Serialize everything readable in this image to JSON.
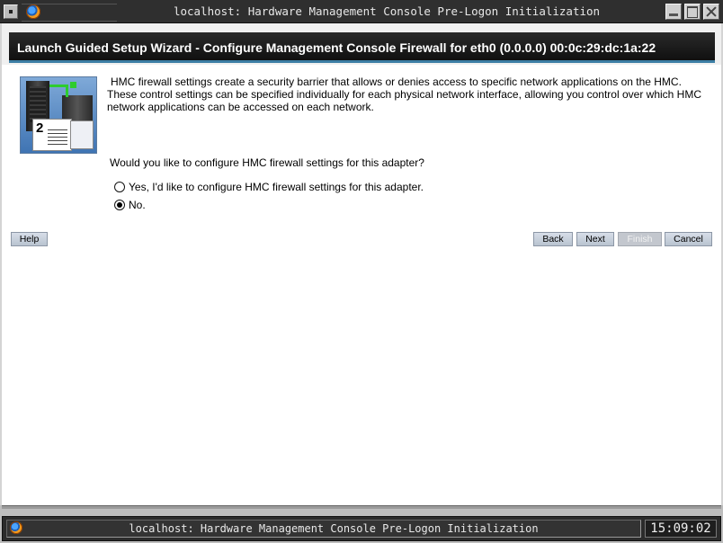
{
  "window": {
    "title": "localhost: Hardware Management Console Pre-Logon Initialization"
  },
  "wizard": {
    "heading": "Launch Guided Setup Wizard - Configure Management Console Firewall for eth0 (0.0.0.0) 00:0c:29:dc:1a:22",
    "step_number": "2",
    "description": "HMC firewall settings create a security barrier that allows or denies access to specific network applications on the HMC. These control settings can be specified individually for each physical network interface, allowing you control over which HMC network applications can be accessed on each network.",
    "question": "Would you like to configure HMC firewall settings for this adapter?",
    "options": [
      {
        "label": "Yes, I'd like to configure HMC firewall settings for this adapter.",
        "selected": false
      },
      {
        "label": "No.",
        "selected": true
      }
    ]
  },
  "buttons": {
    "help": "Help",
    "back": "Back",
    "next": "Next",
    "finish": "Finish",
    "cancel": "Cancel"
  },
  "taskbar": {
    "task_title": "localhost: Hardware Management Console Pre-Logon Initialization",
    "clock": "15:09:02"
  },
  "icons": [
    "window-menu-icon",
    "firefox-icon",
    "minimize-icon",
    "maximize-icon",
    "close-icon"
  ]
}
